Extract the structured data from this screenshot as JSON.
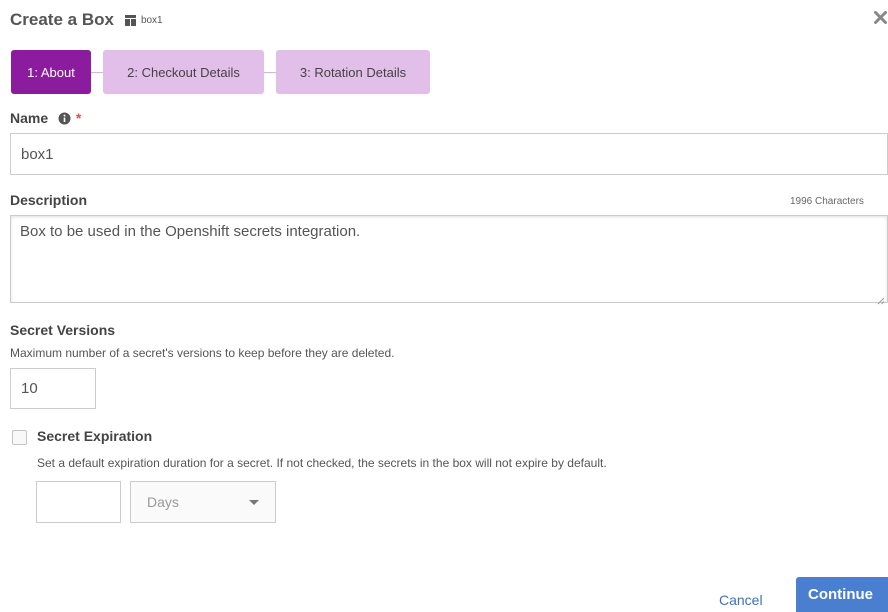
{
  "dialog": {
    "title": "Create a Box",
    "box_name": "box1",
    "close_icon": "close-icon",
    "box_icon": "cube-icon"
  },
  "steps": [
    {
      "label": "1: About",
      "active": true
    },
    {
      "label": "2: Checkout Details",
      "active": false
    },
    {
      "label": "3: Rotation Details",
      "active": false
    }
  ],
  "form": {
    "name": {
      "label": "Name",
      "required_mark": "*",
      "value": "box1",
      "info_icon": "info-icon"
    },
    "description": {
      "label": "Description",
      "value": "Box to be used in the Openshift secrets integration.",
      "char_count": "1996 Characters"
    },
    "secret_versions": {
      "label": "Secret Versions",
      "help": "Maximum number of a secret's versions to keep before they are deleted.",
      "value": "10"
    },
    "secret_expiration": {
      "label": "Secret Expiration",
      "checked": false,
      "help": "Set a default expiration duration for a secret. If not checked, the secrets in the box will not expire by default.",
      "duration_value": "",
      "unit": "Days"
    }
  },
  "footer": {
    "cancel_label": "Cancel",
    "continue_label": "Continue"
  },
  "colors": {
    "step_active": "#8b1c9e",
    "step_inactive": "#e2bfe8",
    "primary_button": "#4a7fd0",
    "link": "#3b73b9",
    "required": "#d9534f"
  }
}
